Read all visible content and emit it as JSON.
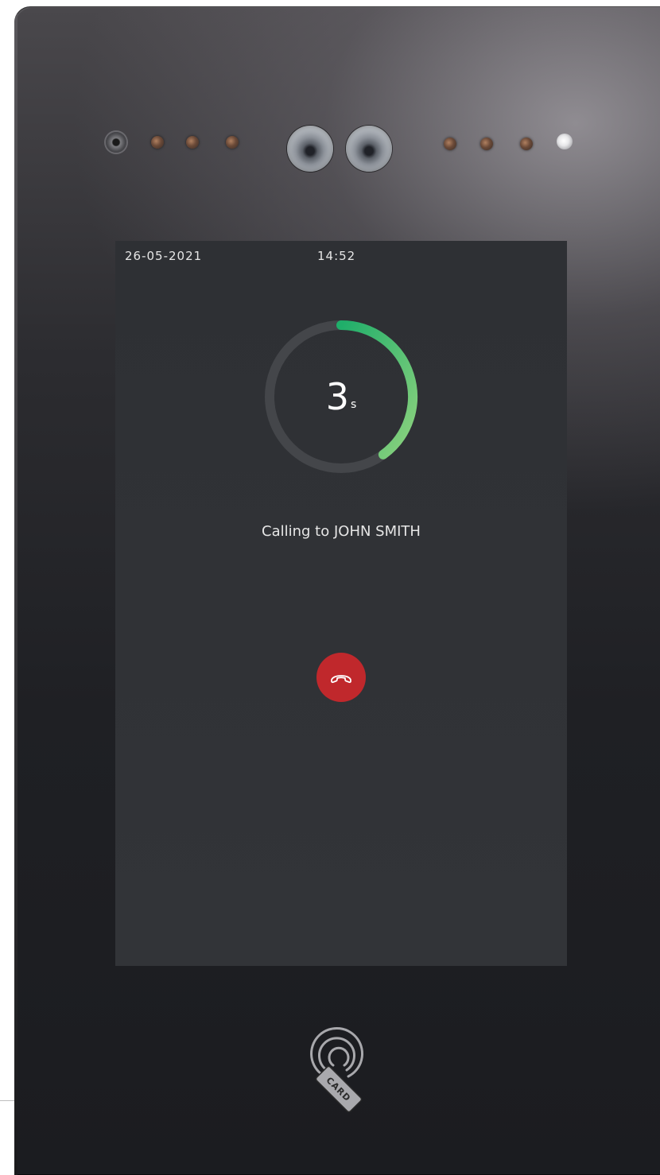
{
  "status_bar": {
    "date": "26-05-2021",
    "time": "14:52"
  },
  "call": {
    "countdown_value": "3",
    "countdown_unit": "s",
    "countdown_progress": 0.4,
    "status_text": "Calling to JOHN SMITH"
  },
  "controls": {
    "hangup_icon": "phone-hangup-icon"
  },
  "card_reader": {
    "label": "CARD",
    "icon": "nfc-card-icon"
  },
  "colors": {
    "ring_track": "#44464a",
    "ring_progress_start": "#1fae6a",
    "ring_progress_end": "#8dd27e",
    "hangup": "#c0282c",
    "screen_bg": "#303236"
  }
}
